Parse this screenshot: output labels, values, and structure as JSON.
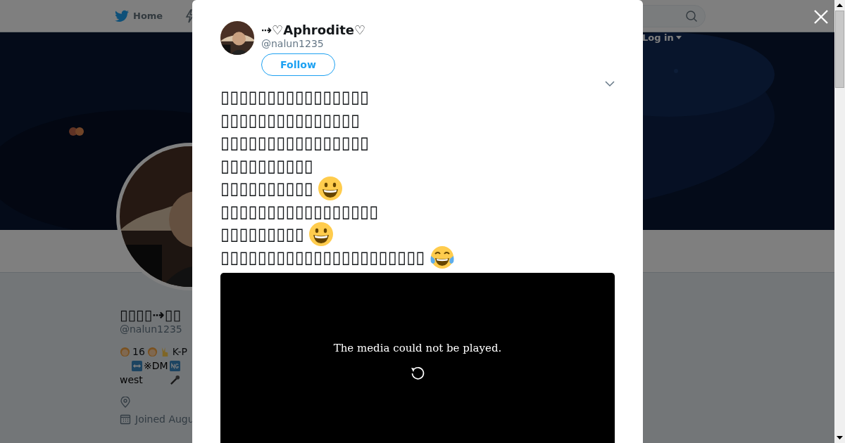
{
  "top_nav": {
    "home": "Home",
    "login": "Log in"
  },
  "profile": {
    "name": "▯▯▯▯⇢▯▯",
    "handle": "@nalun1235",
    "bio": [
      {
        "kind": "age",
        "text": "16"
      },
      {
        "kind": "kpop",
        "text": "K-P"
      }
    ],
    "bio_line2": "※DM",
    "bio_line3": "west",
    "joined": "Joined Augu"
  },
  "tweet_modal": {
    "name": "⇢♡Aphrodite♡",
    "handle": "@nalun1235",
    "follow": "Follow",
    "lines": [
      {
        "kind": "plain",
        "text": "▯▯▯▯▯▯▯▯▯▯▯▯▯▯▯▯"
      },
      {
        "kind": "plain",
        "text": "▯▯▯▯▯▯▯▯▯▯▯▯▯▯▯"
      },
      {
        "kind": "plain",
        "text": "▯▯▯▯▯▯▯▯▯▯▯▯▯▯▯▯"
      },
      {
        "kind": "plain",
        "text": "▯▯▯▯▯▯▯▯▯▯"
      },
      {
        "kind": "grin",
        "text": "▯▯▯▯▯▯▯▯▯▯"
      },
      {
        "kind": "plain",
        "text": "▯▯▯▯▯▯▯▯▯▯▯▯▯▯▯▯▯"
      },
      {
        "kind": "grin",
        "text": "▯▯▯▯▯▯▯▯▯"
      },
      {
        "kind": "joy",
        "text": "▯▯▯▯▯▯▯▯▯▯▯▯▯▯▯▯▯▯▯▯▯▯"
      }
    ],
    "media_error": "The media could not be played."
  }
}
